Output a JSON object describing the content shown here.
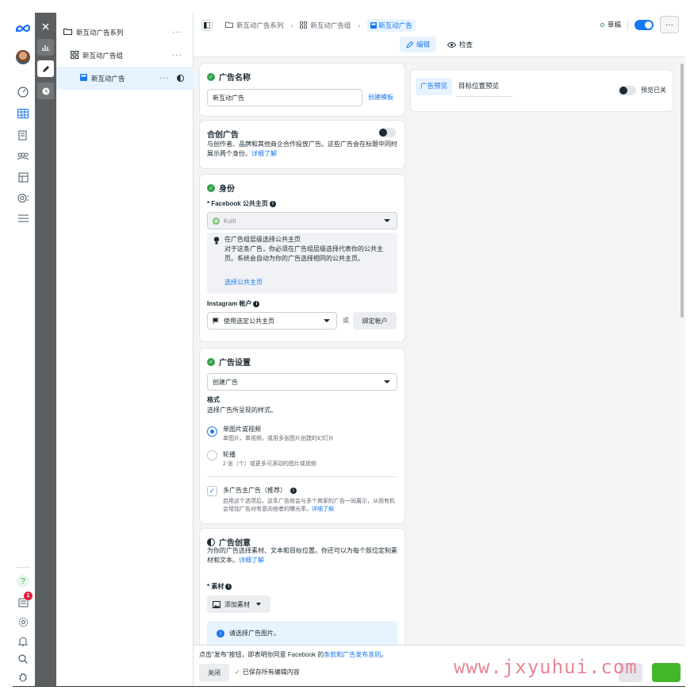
{
  "breadcrumb": {
    "campaign": "新互动广告系列",
    "adset": "新互动广告组",
    "ad": "新互动广告"
  },
  "topbar": {
    "status": "草稿",
    "more": "···"
  },
  "mode_tabs": {
    "edit": "编辑",
    "review": "检查"
  },
  "tree": {
    "campaign": "新互动广告系列",
    "adset": "新互动广告组",
    "ad": "新互动广告",
    "more": "···"
  },
  "rail": {
    "help": "?",
    "notifications_count": "1"
  },
  "ad_name": {
    "title": "广告名称",
    "value": "新互动广告",
    "create_template": "创建模板"
  },
  "partnership": {
    "title": "合创广告",
    "desc": "与创作者、品牌和其他商企合作投放广告。这些广告会在标题中同时展示两个身份。",
    "learn_more": "详细了解"
  },
  "identity": {
    "title": "身份",
    "fb_page_label": "* Facebook 公共主页",
    "fb_page_value": "Kulit",
    "tip_title": "在广告组层级选择公共主页",
    "tip_body": "对于这条广告，你必须在广告组层级选择代表你的公共主页。系统会自动为你的广告选择相同的公共主页。",
    "tip_link": "选择公共主页",
    "ig_label": "Instagram 帐户",
    "ig_value": "使用选定公共主页",
    "or": "或",
    "bind_account": "绑定帐户"
  },
  "ad_setup": {
    "title": "广告设置",
    "create_value": "创建广告",
    "format_label": "格式",
    "format_desc": "选择广告所呈现的样式。",
    "option_single": "单图片或视频",
    "option_single_desc": "单图片、单视频，或用多张图片创建的幻灯片",
    "option_carousel": "轮播",
    "option_carousel_desc": "2 张（个）或更多可滚动的图片或视频",
    "multi_adv": "多广告主广告（推荐）",
    "multi_adv_desc": "启用这个选项后，这条广告就会与多个商家的广告一同展示，从而有机会增加广告对有意向他者的曝光率。",
    "multi_adv_link": "详细了解"
  },
  "creative": {
    "title": "广告创意",
    "desc": "为你的广告选择素材、文本和目标位置。你还可以为每个版位定制素材和文本。",
    "learn_more": "详细了解",
    "media_label": "* 素材",
    "add_media": "添加素材",
    "notice": "请选择广告图片。"
  },
  "preview": {
    "tab_ad": "广告预览",
    "tab_placement": "目标位置预览",
    "preview_off": "预览已关"
  },
  "footer": {
    "terms_prefix": "点击\"发布\"按钮，即表明你同意 Facebook 的",
    "terms_link": "条款和广告发布准则",
    "terms_suffix": "。",
    "close": "关闭",
    "saved": "已保存所有编辑内容"
  },
  "watermark": "www.jxyuhui.com",
  "colors": {
    "accent": "#1877f2",
    "success": "#31a24c",
    "danger": "#e41e3f",
    "strip": "#5b5f62"
  }
}
